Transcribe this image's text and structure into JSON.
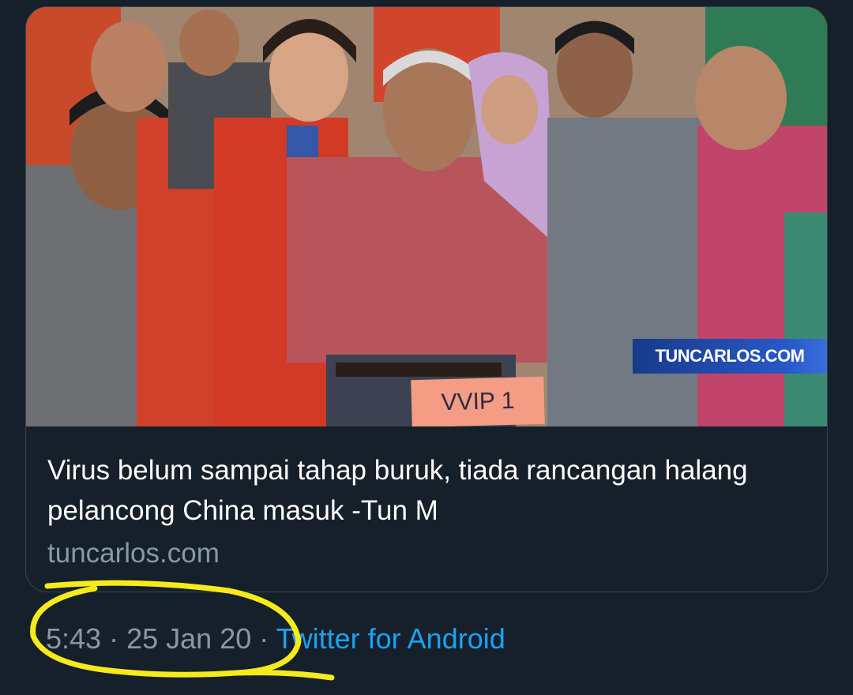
{
  "tweet": {
    "card": {
      "image_watermark": "TUNCARLOS.COM",
      "image_placard": "VVIP 1",
      "headline": "Virus belum sampai tahap buruk, tiada rancangan halang pelancong China masuk -Tun M",
      "domain": "tuncarlos.com"
    },
    "meta": {
      "time": "5:43",
      "separator": "·",
      "date": "25 Jan 20",
      "source": "Twitter for Android"
    }
  },
  "colors": {
    "background": "#15202b",
    "text_primary": "#ffffff",
    "text_secondary": "#8899a6",
    "link": "#1da1f2",
    "highlight_annotation": "#f6ea1c"
  }
}
